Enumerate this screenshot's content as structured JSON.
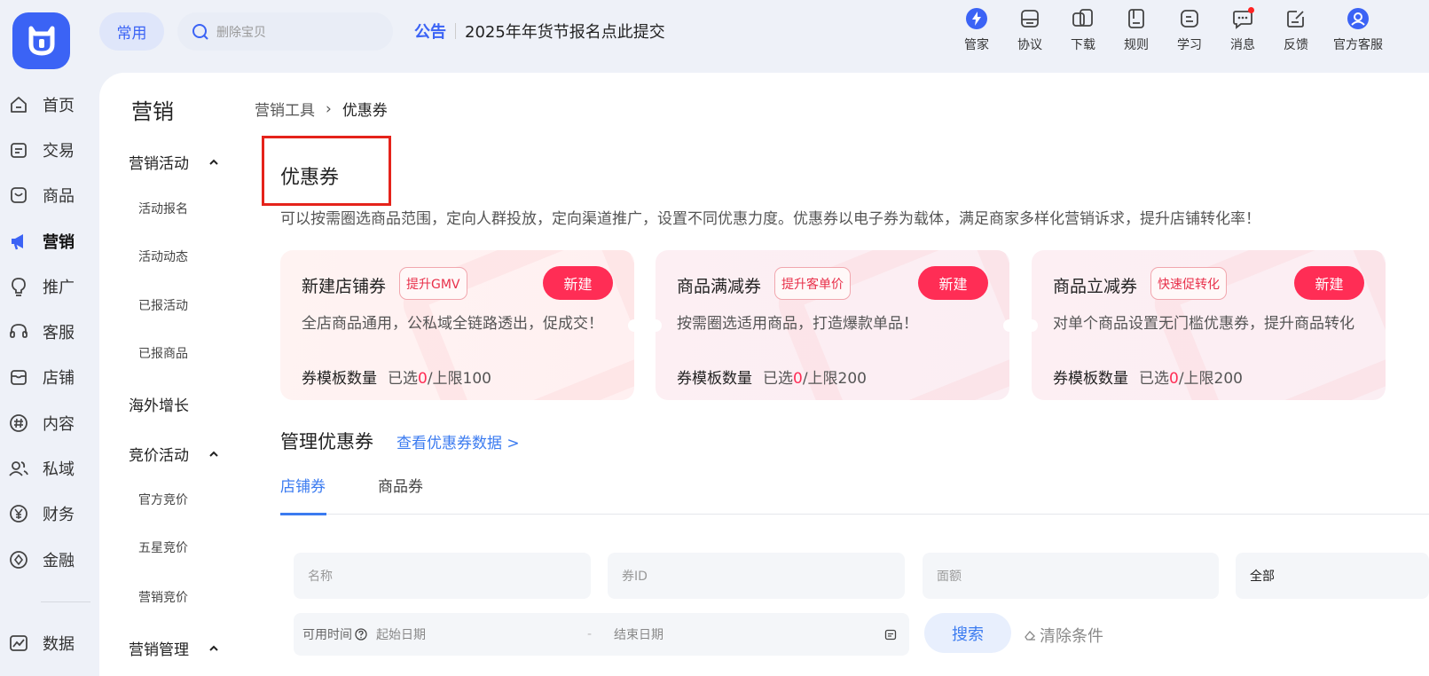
{
  "header": {
    "common_label": "常用",
    "search_placeholder": "删除宝贝",
    "notice_tag": "公告",
    "notice_text": "2025年年货节报名点此提交",
    "tools": [
      {
        "label": "管家",
        "icon": "lightning-icon"
      },
      {
        "label": "协议",
        "icon": "protocol-icon"
      },
      {
        "label": "下载",
        "icon": "download-icon"
      },
      {
        "label": "规则",
        "icon": "rules-icon"
      },
      {
        "label": "学习",
        "icon": "learn-icon"
      },
      {
        "label": "消息",
        "icon": "message-icon"
      },
      {
        "label": "反馈",
        "icon": "feedback-icon"
      },
      {
        "label": "官方客服",
        "icon": "support-icon"
      }
    ]
  },
  "nav": {
    "items": [
      {
        "label": "首页",
        "icon": "home-icon"
      },
      {
        "label": "交易",
        "icon": "trade-icon"
      },
      {
        "label": "商品",
        "icon": "goods-icon"
      },
      {
        "label": "营销",
        "icon": "megaphone-icon"
      },
      {
        "label": "推广",
        "icon": "bulb-icon"
      },
      {
        "label": "客服",
        "icon": "headset-icon"
      },
      {
        "label": "店铺",
        "icon": "store-icon"
      },
      {
        "label": "内容",
        "icon": "hash-icon"
      },
      {
        "label": "私域",
        "icon": "users-icon"
      },
      {
        "label": "财务",
        "icon": "yen-icon"
      },
      {
        "label": "金融",
        "icon": "coin-icon"
      },
      {
        "label": "数据",
        "icon": "chart-icon"
      }
    ]
  },
  "subnav": {
    "title": "营销",
    "group1": "营销活动",
    "group1_items": [
      "活动报名",
      "活动动态",
      "已报活动",
      "已报商品"
    ],
    "group2": "海外增长",
    "group3": "竞价活动",
    "group3_items": [
      "官方竞价",
      "五星竞价",
      "营销竞价"
    ],
    "group4": "营销管理"
  },
  "main": {
    "breadcrumb_parent": "营销工具",
    "breadcrumb_sep": "›",
    "breadcrumb_current": "优惠券",
    "title": "优惠券",
    "description": "可以按需圈选商品范围，定向人群投放，定向渠道推广，设置不同优惠力度。优惠券以电子券为载体，满足商家多样化营销诉求，提升店铺转化率！",
    "cards": [
      {
        "name": "新建店铺券",
        "badge": "提升GMV",
        "button": "新建",
        "desc": "全店商品通用，公私域全链路透出，促成交！",
        "quota_label": "券模板数量",
        "selected_prefix": "已选",
        "selected": "0",
        "limit": "/上限100"
      },
      {
        "name": "商品满减券",
        "badge": "提升客单价",
        "button": "新建",
        "desc": "按需圈选适用商品，打造爆款单品！",
        "quota_label": "券模板数量",
        "selected_prefix": "已选",
        "selected": "0",
        "limit": "/上限200"
      },
      {
        "name": "商品立减券",
        "badge": "快速促转化",
        "button": "新建",
        "desc": "对单个商品设置无门槛优惠券，提升商品转化",
        "quota_label": "券模板数量",
        "selected_prefix": "已选",
        "selected": "0",
        "limit": "/上限200"
      }
    ],
    "manage_title": "管理优惠券",
    "manage_link": "查看优惠券数据 >",
    "tabs": [
      "店铺券",
      "商品券"
    ],
    "filters": {
      "name_placeholder": "名称",
      "id_placeholder": "券ID",
      "amount_placeholder": "面额",
      "status_value": "全部",
      "time_label": "可用时间",
      "start_placeholder": "起始日期",
      "range_sep": "-",
      "end_placeholder": "结束日期",
      "search_label": "搜索",
      "clear_label": "清除条件"
    }
  },
  "colors": {
    "brand": "#3b63f5",
    "accent": "#ff2d55",
    "link": "#3b7bf0",
    "highlight_box": "#e5231b"
  }
}
